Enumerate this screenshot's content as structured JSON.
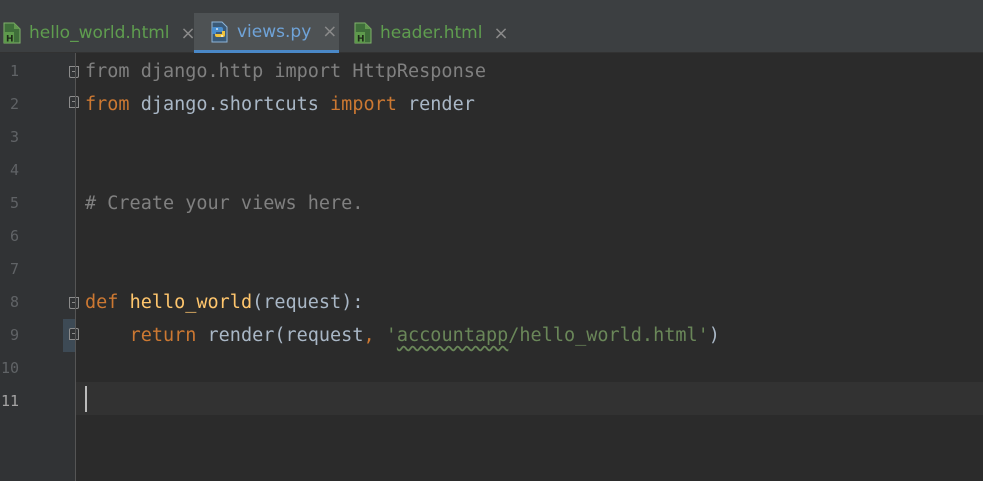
{
  "tabs": [
    {
      "label": "hello_world.html",
      "icon": "html-file-icon",
      "active": false
    },
    {
      "label": "views.py",
      "icon": "python-file-icon",
      "active": true
    },
    {
      "label": "header.html",
      "icon": "html-file-icon",
      "active": false
    }
  ],
  "tab_close_glyph": "×",
  "editor": {
    "line_numbers": [
      "1",
      "2",
      "3",
      "4",
      "5",
      "6",
      "7",
      "8",
      "9",
      "10",
      "11"
    ],
    "current_line": "11",
    "code": {
      "l1": {
        "kw1": "from",
        "mod": " django.http ",
        "kw2": "import",
        "name": " HttpResponse"
      },
      "l2": {
        "kw1": "from",
        "mod": " django.shortcuts ",
        "kw2": "import",
        "name": " render"
      },
      "l5": {
        "comment": "# Create your views here."
      },
      "l8": {
        "kw": "def",
        "space": " ",
        "fn": "hello_world",
        "rest": "(request):"
      },
      "l9": {
        "indent": "    ",
        "kw": "return",
        "call": " render(request",
        "comma": ", ",
        "q1": "'",
        "str_typo": "accountapp",
        "str_rest": "/hello_world.html",
        "q2": "'",
        "close": ")"
      }
    }
  },
  "colors": {
    "background": "#2b2b2b",
    "gutter": "#313335",
    "keyword": "#cc7832",
    "function": "#ffc66d",
    "string": "#6a8759",
    "comment": "#808080",
    "text": "#a9b7c6",
    "active_tab_accent": "#4a88c7"
  }
}
